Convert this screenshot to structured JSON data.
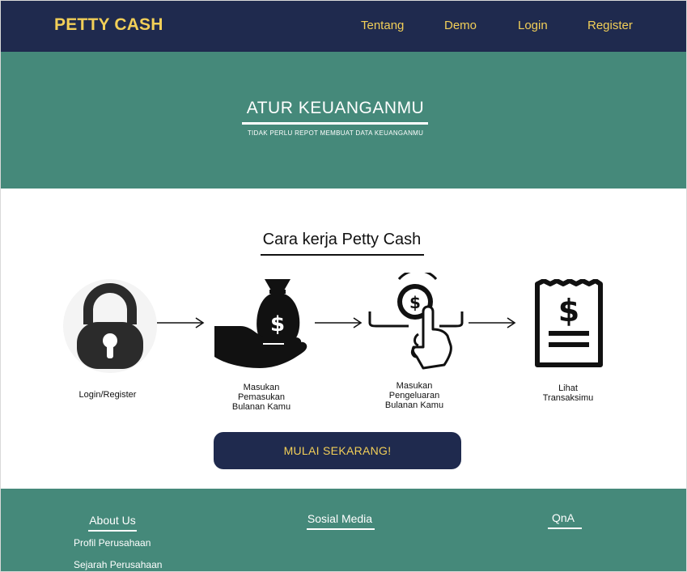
{
  "brand": "PETTY CASH",
  "nav": {
    "items": [
      {
        "label": "Tentang"
      },
      {
        "label": "Demo"
      },
      {
        "label": "Login"
      },
      {
        "label": "Register"
      }
    ]
  },
  "hero": {
    "title": "ATUR KEUANGANMU",
    "subtitle": "TIDAK PERLU REPOT MEMBUAT DATA KEUANGANMU"
  },
  "how": {
    "title": "Cara kerja Petty Cash",
    "steps": [
      {
        "label": "Login/Register",
        "icon": "lock-icon"
      },
      {
        "label": "Masukan Pemasukan Bulanan Kamu",
        "icon": "money-bag-hand-icon"
      },
      {
        "label": "Masukan Pengeluaran Bulanan Kamu",
        "icon": "coin-pay-hand-icon"
      },
      {
        "label": "Lihat Transaksimu",
        "icon": "receipt-icon"
      }
    ],
    "arrow_icon": "arrow-right-icon",
    "cta": "MULAI SEKARANG!"
  },
  "footer": {
    "about": {
      "title": "About Us",
      "links": [
        "Profil Perusahaan",
        "Sejarah Perusahaan"
      ]
    },
    "social": {
      "title": "Sosial Media"
    },
    "qna": {
      "title": "QnA"
    }
  },
  "colors": {
    "navy": "#1f2a4e",
    "accent_yellow": "#f2cf58",
    "teal": "#45897a",
    "white": "#ffffff"
  }
}
